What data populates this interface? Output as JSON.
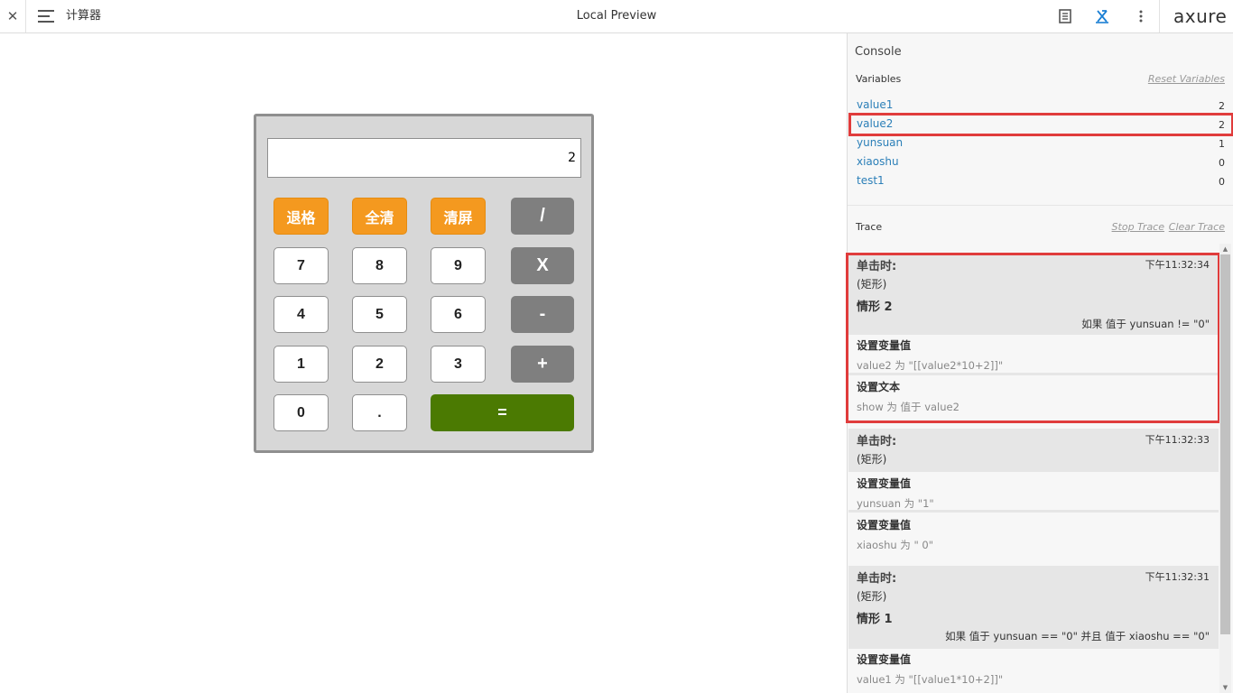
{
  "topbar": {
    "close": "✕",
    "title": "计算器",
    "center": "Local Preview",
    "logo": "axure",
    "icons": [
      "notes-icon",
      "console-icon",
      "more-icon"
    ]
  },
  "calculator": {
    "display": "2",
    "keys": {
      "backspace": "退格",
      "clear_all": "全清",
      "clear_screen": "清屏",
      "divide": "/",
      "multiply": "X",
      "minus": "-",
      "plus": "+",
      "equals": "=",
      "dot": ".",
      "n0": "0",
      "n1": "1",
      "n2": "2",
      "n3": "3",
      "n4": "4",
      "n5": "5",
      "n6": "6",
      "n7": "7",
      "n8": "8",
      "n9": "9"
    },
    "colors": {
      "orange": "#f4991f",
      "gray": "#7f7f7f",
      "green": "#4b7a02"
    }
  },
  "console": {
    "title": "Console",
    "variables_label": "Variables",
    "reset_label": "Reset Variables",
    "variables": [
      {
        "name": "value1",
        "value": "2"
      },
      {
        "name": "value2",
        "value": "2"
      },
      {
        "name": "yunsuan",
        "value": "1"
      },
      {
        "name": "xiaoshu",
        "value": "0"
      },
      {
        "name": "test1",
        "value": "0"
      }
    ],
    "trace_label": "Trace",
    "stop_trace": "Stop Trace",
    "clear_trace": "Clear Trace",
    "highlight_color": "#e03c3c",
    "entries": [
      {
        "event": "单击时:",
        "time": "下午11:32:34",
        "object": "(矩形)",
        "case": "情形 2",
        "condition": "如果 值于 yunsuan != \"0\"",
        "actions": [
          {
            "name": "设置变量值",
            "detail": "value2 为 \"[[value2*10+2]]\""
          },
          {
            "name": "设置文本",
            "detail": "show 为 值于 value2"
          }
        ]
      },
      {
        "event": "单击时:",
        "time": "下午11:32:33",
        "object": "(矩形)",
        "actions": [
          {
            "name": "设置变量值",
            "detail": "yunsuan 为 \"1\""
          },
          {
            "name": "设置变量值",
            "detail": "xiaoshu 为 \" 0\""
          }
        ]
      },
      {
        "event": "单击时:",
        "time": "下午11:32:31",
        "object": "(矩形)",
        "case": "情形 1",
        "condition": "如果 值于 yunsuan == \"0\" 并且 值于 xiaoshu == \"0\"",
        "actions": [
          {
            "name": "设置变量值",
            "detail": "value1 为 \"[[value1*10+2]]\""
          }
        ]
      }
    ]
  }
}
